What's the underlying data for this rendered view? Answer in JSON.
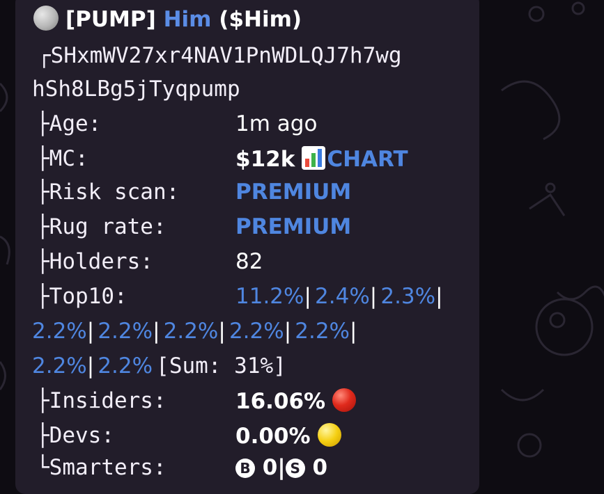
{
  "header": {
    "title_prefix": "[PUMP]",
    "token_name": "Him",
    "token_symbol": "($Him)",
    "avatar_icon": "moon-icon"
  },
  "address": {
    "line1_prefix": "┌",
    "line1": "SHxmWV27xr4NAV1PnWDLQJ7h7wg",
    "line2": "hSh8LBg5jTyqpump"
  },
  "fields": {
    "age": {
      "label": "├Age:",
      "value": "1m ago"
    },
    "mc": {
      "label": "├MC:",
      "value": "$12k",
      "chart_icon": "bar-chart-icon",
      "chart_link": "CHART"
    },
    "risk": {
      "label": "├Risk scan:",
      "value": "PREMIUM"
    },
    "rug": {
      "label": "├Rug rate:",
      "value": "PREMIUM"
    },
    "holders": {
      "label": "├Holders:",
      "value": "82"
    },
    "top10": {
      "label": "├Top10:",
      "values": [
        "11.2%",
        "2.4%",
        "2.3%",
        "2.2%",
        "2.2%",
        "2.2%",
        "2.2%",
        "2.2%",
        "2.2%",
        "2.2%"
      ],
      "separator": "|",
      "sum": "[Sum: 31%]"
    },
    "insiders": {
      "label": "├Insiders:",
      "value": "16.06%",
      "indicator": "red-circle-icon",
      "indicator_color": "#e02a1c"
    },
    "devs": {
      "label": "├Devs:",
      "value": "0.00%",
      "indicator": "yellow-circle-icon",
      "indicator_color": "#f5cf12"
    },
    "smarters": {
      "label": "└Smarters:",
      "b_icon": "B",
      "b_value": "0",
      "sep": "|",
      "s_icon": "S",
      "s_value": "0"
    }
  },
  "colors": {
    "bubble": "#221d2a",
    "link": "#4f86e0",
    "background": "#0e0c12"
  }
}
